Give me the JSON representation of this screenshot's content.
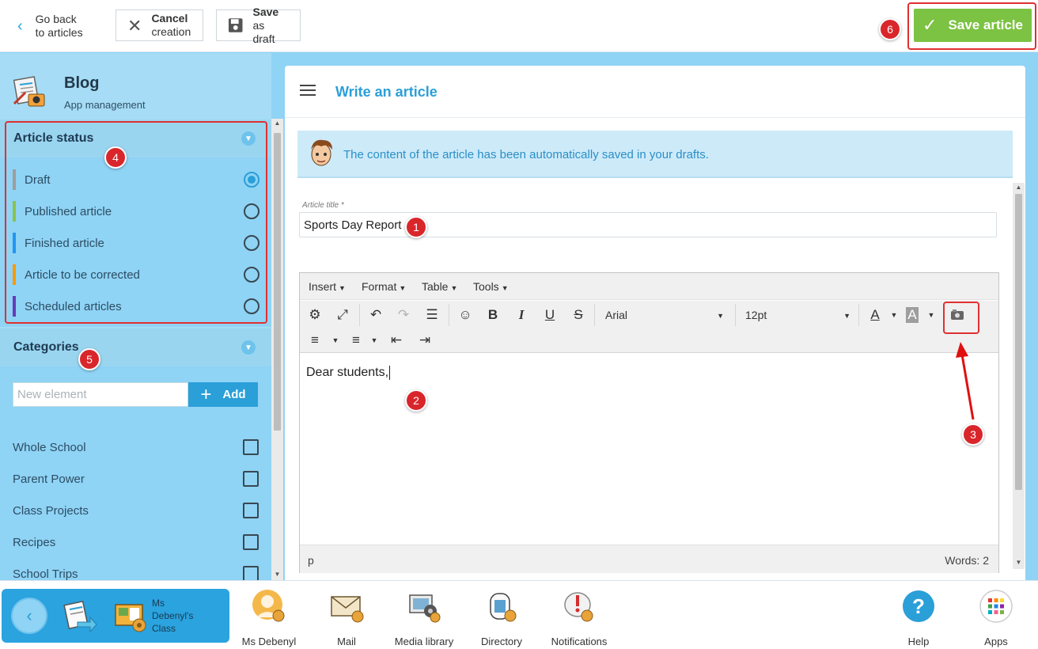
{
  "topbar": {
    "back_line1": "Go back",
    "back_line2": "to articles",
    "cancel_line1": "Cancel",
    "cancel_line2": "creation",
    "draft_line1": "Save",
    "draft_line2": "as draft",
    "save_article": "Save article"
  },
  "badges": [
    "1",
    "2",
    "3",
    "4",
    "5",
    "6"
  ],
  "sidebar": {
    "app_title": "Blog",
    "app_subtitle": "App management",
    "status_header": "Article status",
    "statuses": [
      {
        "label": "Draft",
        "color": "#9e9e9e",
        "selected": true
      },
      {
        "label": "Published article",
        "color": "#8bc34a",
        "selected": false
      },
      {
        "label": "Finished article",
        "color": "#2196f3",
        "selected": false
      },
      {
        "label": "Article to be corrected",
        "color": "#ff9800",
        "selected": false
      },
      {
        "label": "Scheduled articles",
        "color": "#673ab7",
        "selected": false
      }
    ],
    "categories_header": "Categories",
    "new_element_placeholder": "New element",
    "add_label": "Add",
    "categories": [
      "Whole School",
      "Parent Power",
      "Class Projects",
      "Recipes",
      "School Trips"
    ]
  },
  "main": {
    "title": "Write an article",
    "notice": "The content of the article has been automatically saved in your drafts.",
    "title_label": "Article title *",
    "title_value": "Sports Day Report",
    "editor": {
      "menus": [
        "Insert",
        "Format",
        "Table",
        "Tools"
      ],
      "font": "Arial",
      "size": "12pt",
      "body": "Dear students,",
      "path": "p",
      "words": "Words: 2"
    }
  },
  "bottom": {
    "class_name": "Ms Debenyl's Class",
    "apps": [
      "Ms Debenyl",
      "Mail",
      "Media library",
      "Directory",
      "Notifications",
      "Help",
      "Apps"
    ]
  },
  "colors": {
    "accent": "#2a9fd8",
    "save_green": "#7cc243",
    "highlight_red": "#e03030",
    "sidebar_bg": "#a6dcf5"
  }
}
